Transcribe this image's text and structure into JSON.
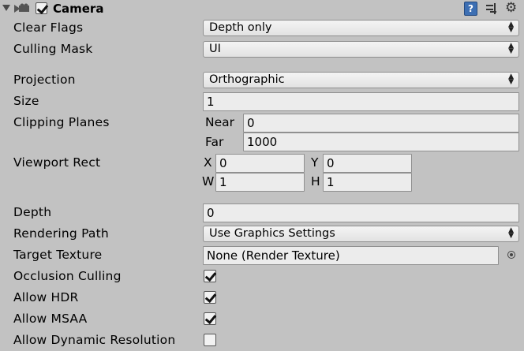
{
  "header": {
    "title": "Camera",
    "enabled": true,
    "icons": [
      "foldout-arrow-icon",
      "camera-icon",
      "help-icon",
      "preset-icon",
      "gear-icon"
    ]
  },
  "clear_flags": {
    "label": "Clear Flags",
    "value": "Depth only"
  },
  "culling_mask": {
    "label": "Culling Mask",
    "value": "UI"
  },
  "projection": {
    "label": "Projection",
    "value": "Orthographic"
  },
  "size": {
    "label": "Size",
    "value": "1"
  },
  "clipping_planes": {
    "label": "Clipping Planes",
    "near_label": "Near",
    "near_value": "0",
    "far_label": "Far",
    "far_value": "1000"
  },
  "viewport_rect": {
    "label": "Viewport Rect",
    "x_label": "X",
    "x_value": "0",
    "y_label": "Y",
    "y_value": "0",
    "w_label": "W",
    "w_value": "1",
    "h_label": "H",
    "h_value": "1"
  },
  "depth": {
    "label": "Depth",
    "value": "0"
  },
  "rendering_path": {
    "label": "Rendering Path",
    "value": "Use Graphics Settings"
  },
  "target_texture": {
    "label": "Target Texture",
    "value": "None (Render Texture)"
  },
  "occlusion_culling": {
    "label": "Occlusion Culling",
    "checked": true
  },
  "allow_hdr": {
    "label": "Allow HDR",
    "checked": true
  },
  "allow_msaa": {
    "label": "Allow MSAA",
    "checked": true
  },
  "allow_dynamic_resolution": {
    "label": "Allow Dynamic Resolution",
    "checked": false
  },
  "colors": {
    "background": "#c2c2c2",
    "field": "#ececec",
    "help_icon": "#3d6fb3"
  }
}
